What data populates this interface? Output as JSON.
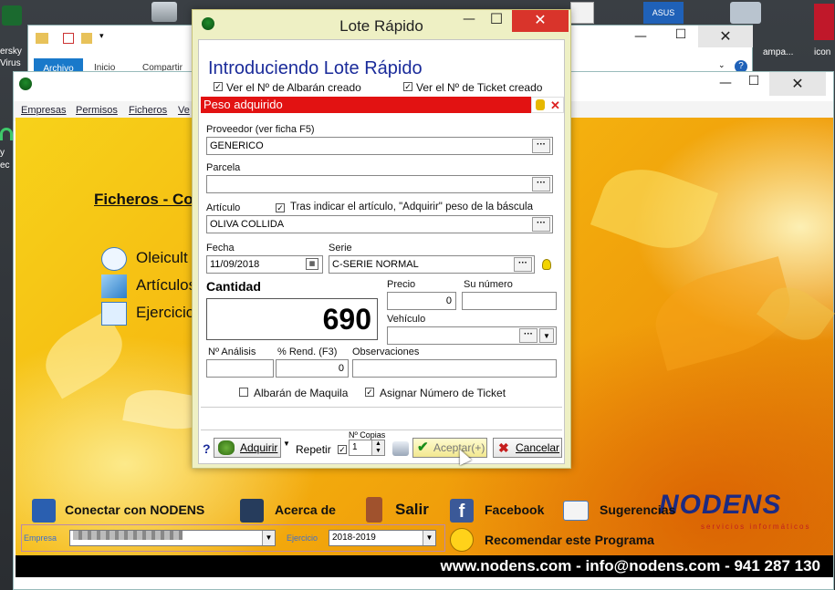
{
  "desktop": {
    "icons": [
      {
        "label": "ersky\nVirus"
      },
      {
        "label": "y"
      },
      {
        "label": "ec"
      }
    ],
    "right_icons": [
      {
        "label": "ampa..."
      },
      {
        "label": "icon"
      }
    ]
  },
  "explorer": {
    "tabs": [
      "Archivo",
      "Inicio",
      "Compartir"
    ]
  },
  "app": {
    "menu": [
      "Empresas",
      "Permisos",
      "Ficheros",
      "Ve"
    ],
    "section_title": "Ficheros - Co",
    "side_items": [
      "Oleicult",
      "Artículos",
      "Ejercicio"
    ],
    "bottom": {
      "conectar": "Conectar con NODENS",
      "acerca": "Acerca de",
      "salir": "Salir",
      "facebook": "Facebook",
      "sugerencias": "Sugerencias",
      "recomendar": "Recomendar este Programa",
      "empresa_label": "Empresa",
      "ejercicio_label": "Ejercicio",
      "ejercicio_value": "2018-2019"
    },
    "footer": "www.nodens.com  -  info@nodens.com  -  941 287 130",
    "logo": {
      "name": "NODENS",
      "tagline": "servicios informáticos"
    }
  },
  "dialog": {
    "title": "Lote Rápido",
    "close_glyph": "✕",
    "heading": "Introduciendo Lote Rápido",
    "opt_albaran": "Ver el Nº de Albarán creado",
    "opt_ticket": "Ver el Nº de Ticket creado",
    "section_bar": "Peso adquirido",
    "proveedor_label": "Proveedor (ver ficha F5)",
    "proveedor_value": "GENERICO",
    "parcela_label": "Parcela",
    "parcela_value": "",
    "articulo_label": "Artículo",
    "articulo_opt": "Tras indicar el artículo, \"Adquirir\" peso de la báscula",
    "articulo_value": "OLIVA COLLIDA",
    "fecha_label": "Fecha",
    "fecha_value": "11/09/2018",
    "serie_label": "Serie",
    "serie_value": "C-SERIE NORMAL",
    "cantidad_label": "Cantidad",
    "cantidad_value": "690",
    "precio_label": "Precio",
    "precio_value": "0",
    "su_numero_label": "Su número",
    "su_numero_value": "",
    "vehiculo_label": "Vehículo",
    "vehiculo_value": "",
    "analisis_label": "Nº Análisis",
    "analisis_value": "",
    "rend_label": "% Rend. (F3)",
    "rend_value": "0",
    "obs_label": "Observaciones",
    "obs_value": "",
    "maquila_label": "Albarán de Maquila",
    "asignar_label": "Asignar Número de Ticket",
    "help": "?",
    "adquirir": "Adquirir",
    "repetir": "Repetir",
    "copias_label": "Nº Copias",
    "copias_value": "1",
    "aceptar": "Aceptar(+)",
    "cancelar": "Cancelar"
  }
}
